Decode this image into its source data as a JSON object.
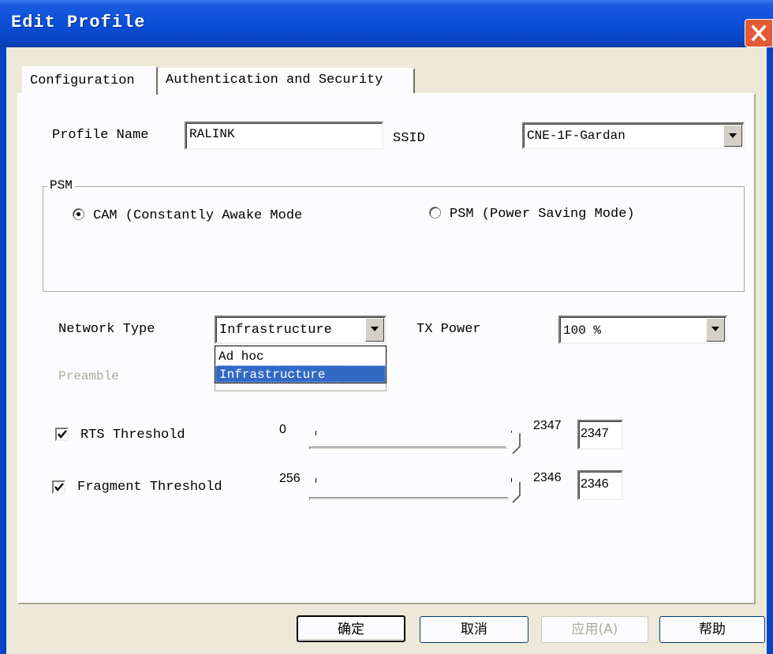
{
  "window": {
    "title": "Edit Profile"
  },
  "tabs": [
    {
      "label": "Configuration",
      "active": true
    },
    {
      "label": "Authentication and Security",
      "active": false
    }
  ],
  "profile": {
    "name_label": "Profile Name",
    "name_value": "RALINK",
    "ssid_label": "SSID",
    "ssid_value": "CNE-1F-Gardan"
  },
  "psm": {
    "legend": "PSM",
    "options": [
      {
        "label": "CAM (Constantly Awake Mode",
        "selected": true
      },
      {
        "label": "PSM (Power Saving Mode)",
        "selected": false
      }
    ]
  },
  "network": {
    "type_label": "Network Type",
    "type_value": "Infrastructure",
    "type_options": [
      "Ad hoc",
      "Infrastructure"
    ],
    "tx_label": "TX Power",
    "tx_value": "100 %",
    "preamble_label": "Preamble"
  },
  "rts": {
    "label": "RTS Threshold",
    "checked": true,
    "min": "0",
    "max": "2347",
    "value": "2347"
  },
  "fragment": {
    "label": "Fragment Threshold",
    "checked": true,
    "min": "256",
    "max": "2346",
    "value": "2346"
  },
  "buttons": {
    "ok": "确定",
    "cancel": "取消",
    "apply": "应用(A)",
    "help": "帮助"
  },
  "colors": {
    "titlebar": "#0a4fd6",
    "selection": "#316ac5",
    "close": "#e45a35"
  }
}
